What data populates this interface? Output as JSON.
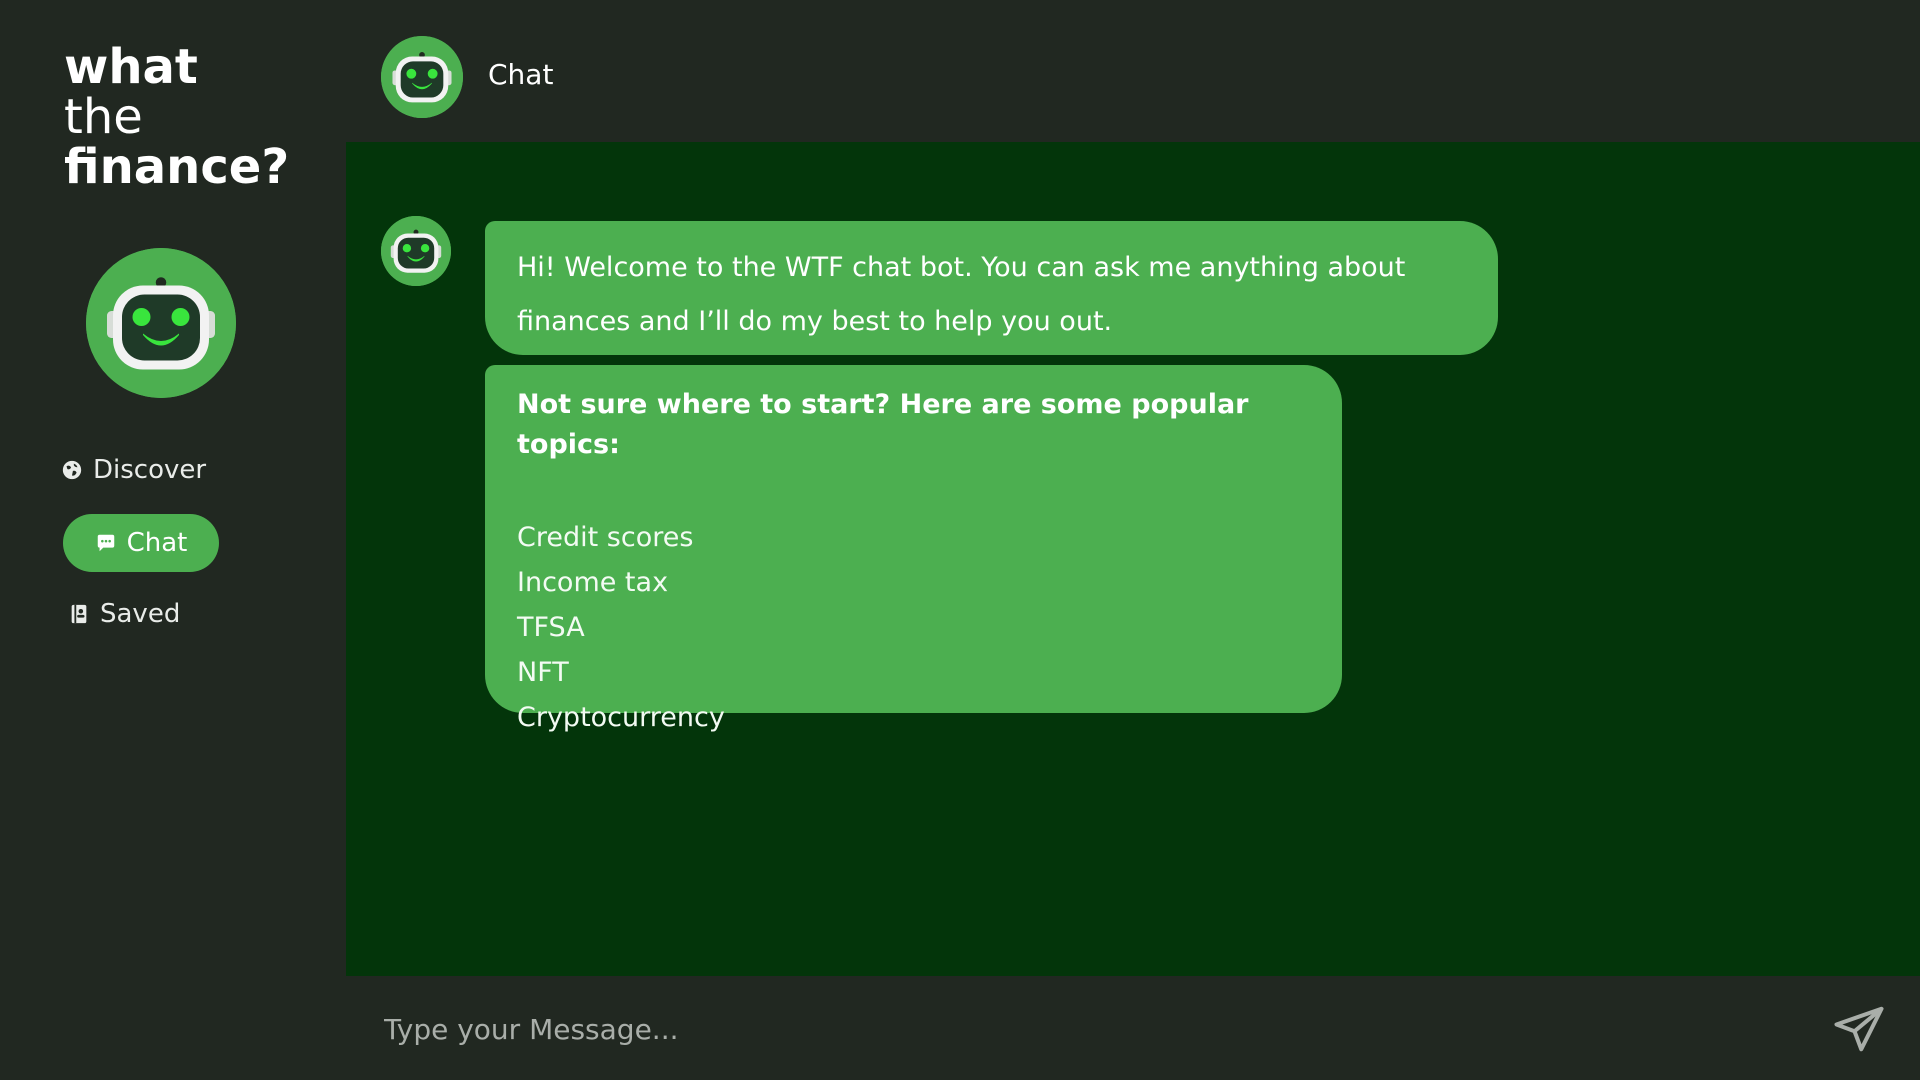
{
  "brand": {
    "line1": "what",
    "line2": "the",
    "line3": "finance?"
  },
  "sidebar": {
    "items": [
      {
        "label": "Discover",
        "icon": "globe-icon",
        "active": false
      },
      {
        "label": "Chat",
        "icon": "chat-icon",
        "active": true
      },
      {
        "label": "Saved",
        "icon": "bookmark-icon",
        "active": false
      }
    ]
  },
  "header": {
    "title": "Chat",
    "avatar_icon": "robot-icon"
  },
  "chat": {
    "messages": [
      {
        "sender": "bot",
        "text": "Hi! Welcome to the WTF chat bot. You can ask me anything about finances and I’ll do my best to help you out."
      }
    ],
    "topics": {
      "heading": "Not sure where to start? Here are some popular topics:",
      "items": [
        "Credit scores",
        "Income tax",
        "TFSA",
        "NFT",
        "Cryptocurrency"
      ]
    }
  },
  "input": {
    "placeholder": "Type your Message...",
    "value": "",
    "send_icon": "send-icon"
  },
  "colors": {
    "accent": "#4CAF50",
    "background": "#212821",
    "chat_background": "#03350A"
  }
}
